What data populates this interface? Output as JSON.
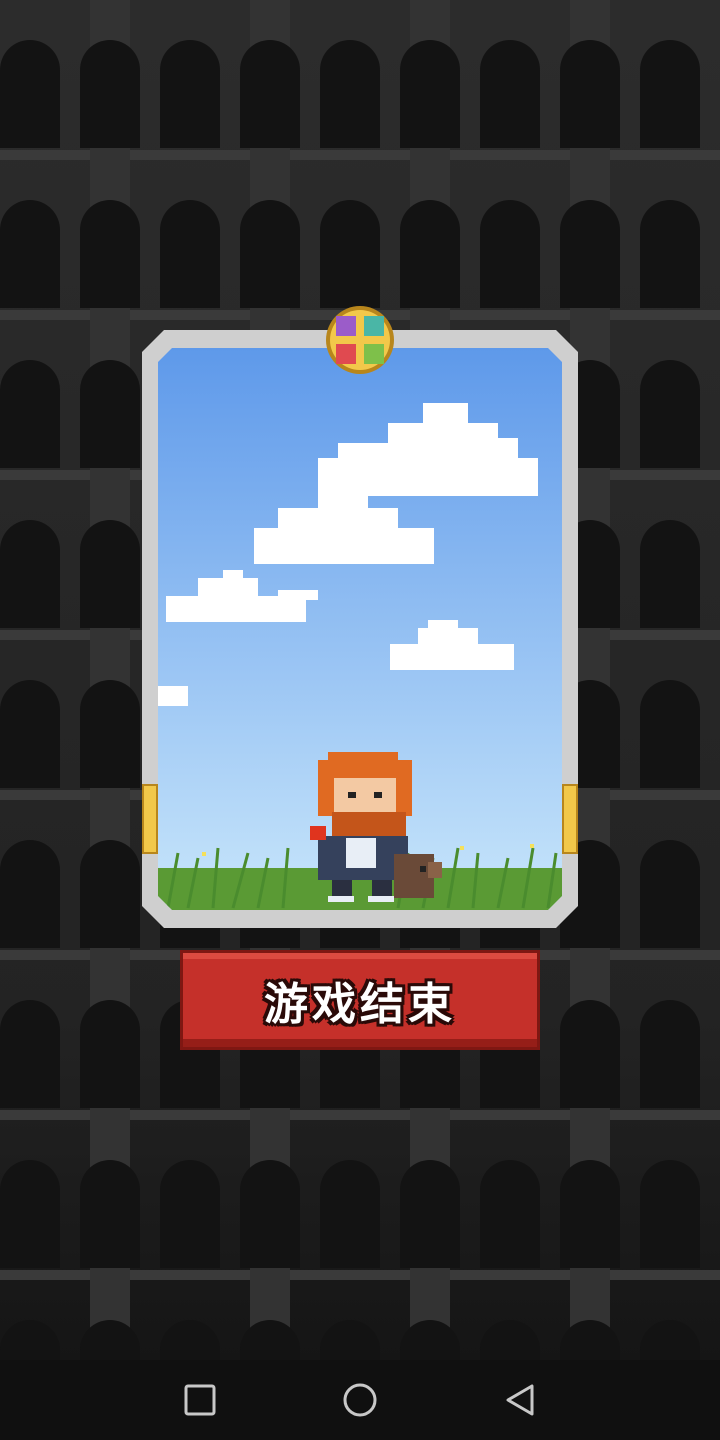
{
  "screen": {
    "title": "游戏结束",
    "background_color": "#181818"
  },
  "card": {
    "frame_color": "#cfcfcf",
    "sky_top_color": "#5e99ea",
    "sky_bottom_color": "#c8e6fb",
    "emblem_icon": "four-color-cross-emblem",
    "character_icon": "bearded-red-haired-knight",
    "companion_icon": "brown-dog"
  },
  "game_over_button": {
    "label": "游戏结束",
    "color": "#c5302a"
  },
  "nav_bar": {
    "recents_icon": "square-icon",
    "home_icon": "circle-icon",
    "back_icon": "triangle-back-icon"
  }
}
